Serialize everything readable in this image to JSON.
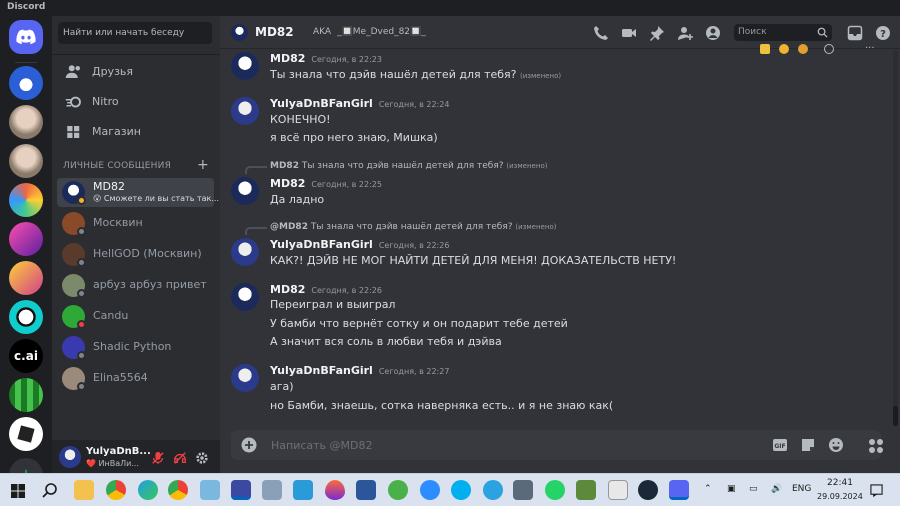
{
  "app": {
    "title": "Discord"
  },
  "sidebar": {
    "search_placeholder": "Найти или начать беседу",
    "nav": [
      {
        "label": "Друзья"
      },
      {
        "label": "Nitro"
      },
      {
        "label": "Магазин"
      }
    ],
    "dm_header": "ЛИЧНЫЕ СООБЩЕНИЯ",
    "dms": [
      {
        "name": "MD82",
        "status_text": "😮 Сможете ли вы стать так...",
        "active": true,
        "status": "idle"
      },
      {
        "name": "Москвин",
        "status": "off"
      },
      {
        "name": "HellGOD (Москвин)",
        "status": "off"
      },
      {
        "name": "арбуз арбуз привет",
        "status": "off"
      },
      {
        "name": "Candu",
        "status": "dnd"
      },
      {
        "name": "Shadic Python",
        "status": "off"
      },
      {
        "name": "Elina5564",
        "status": "off"
      }
    ],
    "servers_text": {
      "cai": "c.ai"
    }
  },
  "user_panel": {
    "name": "YulyaDnB...",
    "status": "❤️ ИнВаЛи..."
  },
  "header": {
    "name": "MD82",
    "aka_label": "AKA",
    "aka_value": "_🔲Me_Dved_82🔲_",
    "search_placeholder": "Поиск"
  },
  "messages": [
    {
      "author": "MD82",
      "time": "Сегодня, в 22:23",
      "lines": [
        "Ты знала что дэйв нашёл детей для тебя?"
      ],
      "edited": "(изменено)"
    },
    {
      "author": "YulyaDnBFanGirl",
      "time": "Сегодня, в 22:24",
      "lines": [
        "КОНЕЧНО!",
        "я всё про него знаю, Мишка)"
      ]
    },
    {
      "reply_author": "MD82",
      "reply_text": "Ты знала что дэйв нашёл детей для тебя?",
      "reply_edited": "(изменено)",
      "author": "MD82",
      "time": "Сегодня, в 22:25",
      "lines": [
        "Да ладно"
      ]
    },
    {
      "reply_author": "@MD82",
      "reply_text": "Ты знала что дэйв нашёл детей для тебя?",
      "reply_edited": "(изменено)",
      "author": "YulyaDnBFanGirl",
      "time": "Сегодня, в 22:26",
      "lines": [
        "КАК?! ДЭЙВ НЕ МОГ НАЙТИ ДЕТЕЙ ДЛЯ МЕНЯ! ДОКАЗАТЕЛЬСТВ НЕТУ!"
      ]
    },
    {
      "author": "MD82",
      "time": "Сегодня, в 22:26",
      "lines": [
        "Переиграл и выиграл",
        "У бамби что вернёт сотку и он подарит тебе детей",
        "А значит вся соль в любви тебя и дэйва"
      ]
    },
    {
      "author": "YulyaDnBFanGirl",
      "time": "Сегодня, в 22:27",
      "lines": [
        "ага)",
        "но Бамби, знаешь, сотка наверняка есть.. и я не знаю как("
      ]
    }
  ],
  "composer": {
    "placeholder": "Написать @MD82"
  },
  "taskbar": {
    "lang": "ENG",
    "time": "22:41",
    "date": "29.09.2024"
  },
  "colors": {
    "blurple": "#5865f2",
    "bg": "#313338",
    "sidebar": "#2b2d31"
  }
}
